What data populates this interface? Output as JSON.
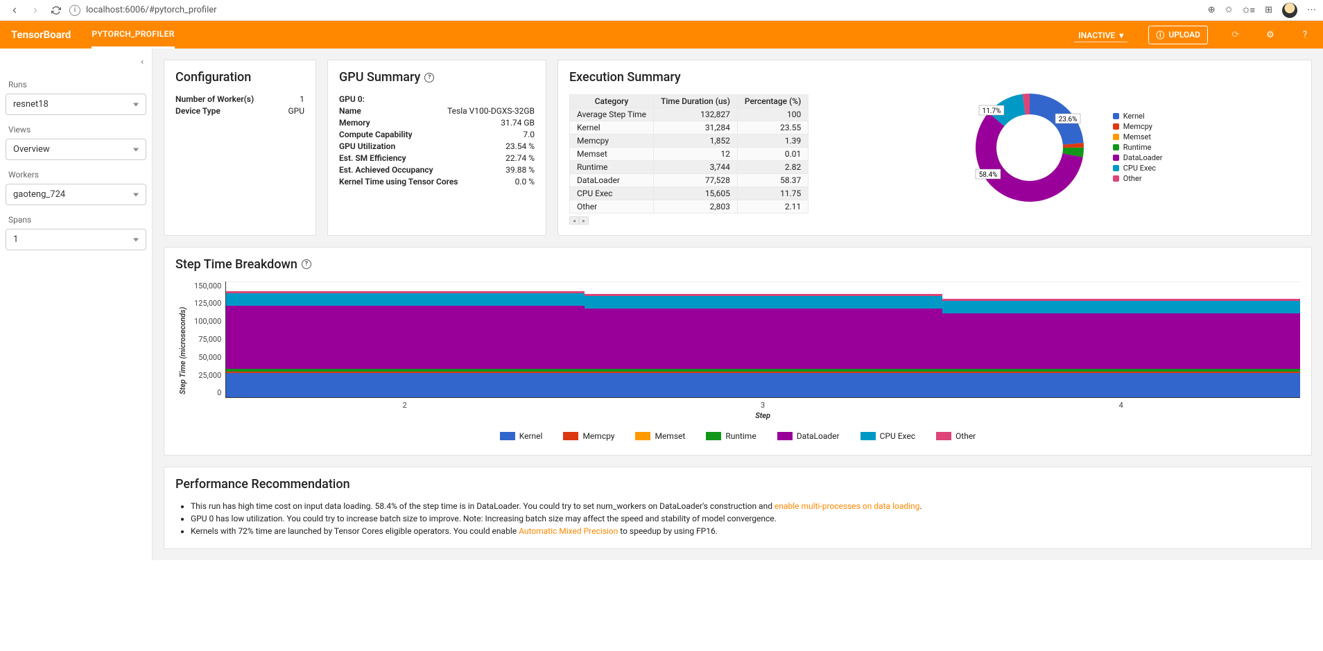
{
  "browser": {
    "url": "localhost:6006/#pytorch_profiler"
  },
  "header": {
    "logo": "TensorBoard",
    "tab": "PYTORCH_PROFILER",
    "status": "INACTIVE",
    "upload": "UPLOAD"
  },
  "sidebar": {
    "runs_label": "Runs",
    "runs_value": "resnet18",
    "views_label": "Views",
    "views_value": "Overview",
    "workers_label": "Workers",
    "workers_value": "gaoteng_724",
    "spans_label": "Spans",
    "spans_value": "1"
  },
  "config": {
    "title": "Configuration",
    "rows": [
      {
        "k": "Number of Worker(s)",
        "v": "1"
      },
      {
        "k": "Device Type",
        "v": "GPU"
      }
    ]
  },
  "gpu": {
    "title": "GPU Summary",
    "header": "GPU 0:",
    "rows": [
      {
        "k": "Name",
        "v": "Tesla V100-DGXS-32GB"
      },
      {
        "k": "Memory",
        "v": "31.74 GB"
      },
      {
        "k": "Compute Capability",
        "v": "7.0"
      },
      {
        "k": "GPU Utilization",
        "v": "23.54 %"
      },
      {
        "k": "Est. SM Efficiency",
        "v": "22.74 %"
      },
      {
        "k": "Est. Achieved Occupancy",
        "v": "39.88 %"
      },
      {
        "k": "Kernel Time using Tensor Cores",
        "v": "0.0 %"
      }
    ]
  },
  "exec": {
    "title": "Execution Summary",
    "cols": [
      "Category",
      "Time Duration (us)",
      "Percentage (%)"
    ],
    "rows": [
      [
        "Average Step Time",
        "132,827",
        "100"
      ],
      [
        "Kernel",
        "31,284",
        "23.55"
      ],
      [
        "Memcpy",
        "1,852",
        "1.39"
      ],
      [
        "Memset",
        "12",
        "0.01"
      ],
      [
        "Runtime",
        "3,744",
        "2.82"
      ],
      [
        "DataLoader",
        "77,528",
        "58.37"
      ],
      [
        "CPU Exec",
        "15,605",
        "11.75"
      ],
      [
        "Other",
        "2,803",
        "2.11"
      ]
    ]
  },
  "colors": {
    "Kernel": "#3366cc",
    "Memcpy": "#dc3912",
    "Memset": "#ff9900",
    "Runtime": "#109618",
    "DataLoader": "#990099",
    "CPU Exec": "#0099c6",
    "Other": "#dd4477"
  },
  "donut_legend": [
    "Kernel",
    "Memcpy",
    "Memset",
    "Runtime",
    "DataLoader",
    "CPU Exec",
    "Other"
  ],
  "breakdown": {
    "title": "Step Time Breakdown",
    "ylabel": "Step Time (microseconds)",
    "xlabel": "Step"
  },
  "chart_data": [
    {
      "type": "pie",
      "title": "Execution Summary",
      "series": [
        {
          "name": "Kernel",
          "value": 23.6
        },
        {
          "name": "Memcpy",
          "value": 1.39
        },
        {
          "name": "Memset",
          "value": 0.01
        },
        {
          "name": "Runtime",
          "value": 2.82
        },
        {
          "name": "DataLoader",
          "value": 58.4
        },
        {
          "name": "CPU Exec",
          "value": 11.7
        },
        {
          "name": "Other",
          "value": 2.11
        }
      ],
      "labels_shown": [
        "23.6%",
        "58.4%",
        "11.7%"
      ]
    },
    {
      "type": "bar",
      "stacked": true,
      "title": "Step Time Breakdown",
      "xlabel": "Step",
      "ylabel": "Step Time (microseconds)",
      "ylim": [
        0,
        150000
      ],
      "yticks": [
        0,
        25000,
        50000,
        75000,
        100000,
        125000,
        150000
      ],
      "categories": [
        "2",
        "3",
        "4"
      ],
      "series": [
        {
          "name": "Kernel",
          "values": [
            31000,
            31000,
            31000
          ]
        },
        {
          "name": "Memcpy",
          "values": [
            1900,
            1900,
            1900
          ]
        },
        {
          "name": "Memset",
          "values": [
            12,
            12,
            12
          ]
        },
        {
          "name": "Runtime",
          "values": [
            3700,
            3700,
            3700
          ]
        },
        {
          "name": "DataLoader",
          "values": [
            82000,
            78000,
            72000
          ]
        },
        {
          "name": "CPU Exec",
          "values": [
            16000,
            16000,
            16000
          ]
        },
        {
          "name": "Other",
          "values": [
            2800,
            2800,
            2800
          ]
        }
      ]
    }
  ],
  "perf": {
    "title": "Performance Recommendation",
    "items": [
      {
        "pre": "This run has high time cost on input data loading. 58.4% of the step time is in DataLoader. You could try to set num_workers on DataLoader's construction and ",
        "link": "enable multi-processes on data loading",
        "post": "."
      },
      {
        "pre": "GPU 0 has low utilization. You could try to increase batch size to improve. Note: Increasing batch size may affect the speed and stability of model convergence.",
        "link": "",
        "post": ""
      },
      {
        "pre": "Kernels with 72% time are launched by Tensor Cores eligible operators. You could enable ",
        "link": "Automatic Mixed Precision",
        "post": " to speedup by using FP16."
      }
    ]
  }
}
